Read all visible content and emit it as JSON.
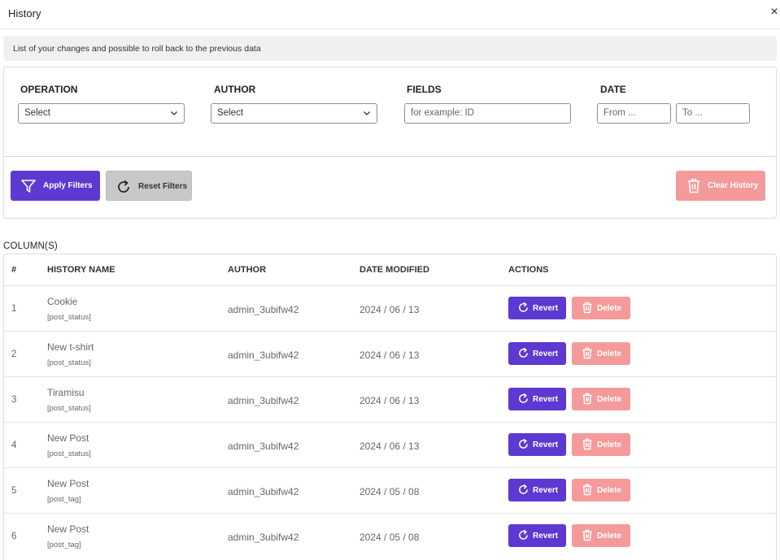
{
  "header": {
    "title": "History",
    "close_glyph": "×"
  },
  "info_text": "List of your changes and possible to roll back to the previous data",
  "filters": {
    "operation": {
      "label": "OPERATION",
      "value": "Select"
    },
    "author": {
      "label": "AUTHOR",
      "value": "Select"
    },
    "fields": {
      "label": "FIELDS",
      "placeholder": "for example: ID"
    },
    "date": {
      "label": "DATE",
      "from_placeholder": "From ...",
      "to_placeholder": "To ..."
    }
  },
  "buttons": {
    "apply": "Apply Filters",
    "reset": "Reset Filters",
    "clear": "Clear History"
  },
  "columns_label": "COLUMN(S)",
  "table": {
    "headers": {
      "index": "#",
      "name": "HISTORY NAME",
      "author": "AUTHOR",
      "date": "DATE MODIFIED",
      "actions": "ACTIONS"
    },
    "revert_label": "Revert",
    "delete_label": "Delete",
    "rows": [
      {
        "index": "1",
        "name": "Cookie",
        "field": "[post_status]",
        "author": "admin_3ubifw42",
        "date": "2024 / 06 / 13"
      },
      {
        "index": "2",
        "name": "New t-shirt",
        "field": "[post_status]",
        "author": "admin_3ubifw42",
        "date": "2024 / 06 / 13"
      },
      {
        "index": "3",
        "name": "Tiramisu",
        "field": "[post_status]",
        "author": "admin_3ubifw42",
        "date": "2024 / 06 / 13"
      },
      {
        "index": "4",
        "name": "New Post",
        "field": "[post_status]",
        "author": "admin_3ubifw42",
        "date": "2024 / 06 / 13"
      },
      {
        "index": "5",
        "name": "New Post",
        "field": "[post_tag]",
        "author": "admin_3ubifw42",
        "date": "2024 / 05 / 08"
      },
      {
        "index": "6",
        "name": "New Post",
        "field": "[post_tag]",
        "author": "admin_3ubifw42",
        "date": "2024 / 05 / 08"
      }
    ]
  },
  "colors": {
    "primary": "#5d39d1",
    "danger_light": "#f59a9a",
    "reset_bg": "#c8c8c8",
    "info_bg": "#f0f0f1"
  }
}
